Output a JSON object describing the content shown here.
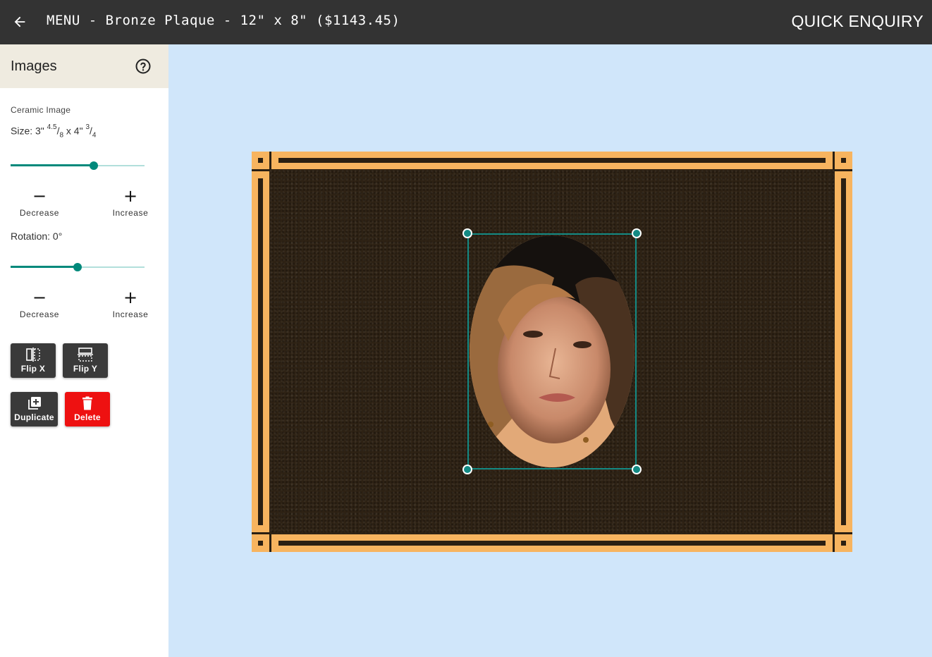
{
  "header": {
    "back_icon": "arrow-left-icon",
    "title": "MENU - Bronze Plaque - 12\" x 8\" ($1143.45)",
    "quick_enquiry": "QUICK ENQUIRY"
  },
  "panel": {
    "title": "Images",
    "help_icon": "help-circle-icon",
    "section": "Ceramic Image",
    "size": {
      "prefix": "Size: 3\"",
      "width_num": "4.5",
      "width_den": "8",
      "separator": "x 4\"",
      "height_num": "3",
      "height_den": "4"
    },
    "size_slider_value": 0.62,
    "size_decrease": "Decrease",
    "size_increase": "Increase",
    "rotation": "Rotation: 0°",
    "rotation_slider_value": 0.5,
    "rotation_decrease": "Decrease",
    "rotation_increase": "Increase",
    "buttons": {
      "flip_x": "Flip X",
      "flip_y": "Flip Y",
      "duplicate": "Duplicate",
      "delete": "Delete"
    }
  },
  "colors": {
    "topbar": "#333333",
    "canvas_bg": "#d0e6fa",
    "accent": "#00897b",
    "plaque_border": "#f7b45f",
    "plaque_face": "#2e2214",
    "delete": "#ee1111"
  }
}
